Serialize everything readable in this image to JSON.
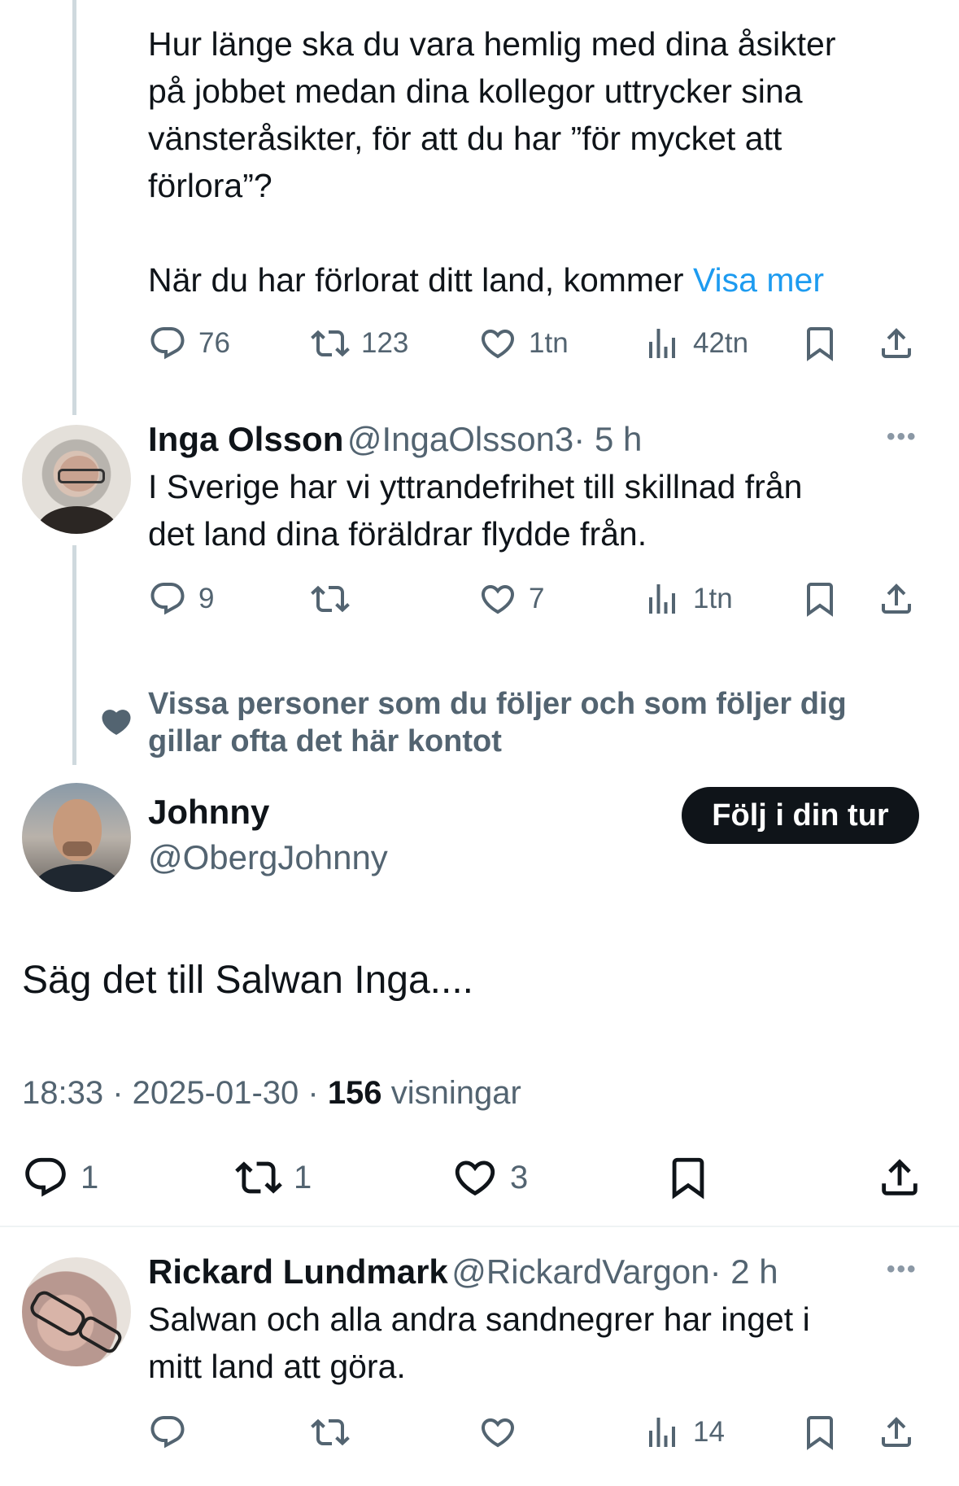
{
  "tweet1": {
    "text_line1": "Hur länge ska du vara hemlig med dina åsikter",
    "text_line2": "på jobbet medan dina kollegor uttrycker sina",
    "text_line3": "vänsteråsikter, för att du har ”för mycket att",
    "text_line4": "förlora”?",
    "text_line5": "När du har förlorat ditt land, kommer",
    "show_more": "Visa mer",
    "replies": "76",
    "retweets": "123",
    "likes": "1tn",
    "views": "42tn"
  },
  "tweet2": {
    "name": "Inga Olsson",
    "handle": "@IngaOlsson3",
    "time": "· 5 h",
    "text_line1": "I Sverige har vi yttrandefrihet till skillnad från",
    "text_line2": "det land dina föräldrar flydde från.",
    "replies": "9",
    "likes": "7",
    "views": "1tn"
  },
  "social_context": {
    "line1": "Vissa personer som du följer och som följer dig",
    "line2": "gillar ofta det här kontot"
  },
  "main_tweet": {
    "name": "Johnny",
    "handle": "@ObergJohnny",
    "follow_label": "Följ i din tur",
    "text": "Säg det till Salwan Inga....",
    "time": "18:33 · 2025-01-30 ·",
    "views_count": "156",
    "views_label": "visningar",
    "replies": "1",
    "retweets": "1",
    "likes": "3"
  },
  "tweet3": {
    "name": "Rickard Lundmark",
    "handle": "@RickardVargon",
    "time": "· 2 h",
    "text_line1": "Salwan och alla andra sandnegrer har inget i",
    "text_line2": "mitt land att göra.",
    "views": "14"
  },
  "more_label": "•••",
  "colors": {
    "text": "#0f1419",
    "secondary": "#536471",
    "link": "#1d9bf0",
    "thread": "#cfd9de"
  }
}
